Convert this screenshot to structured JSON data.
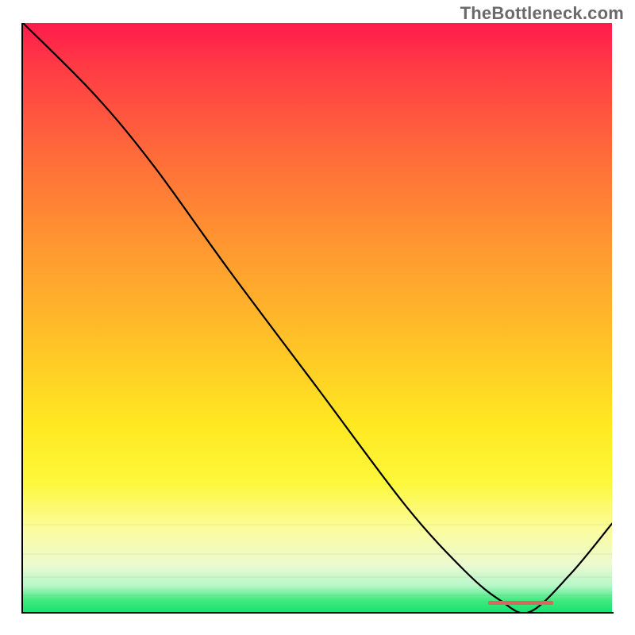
{
  "watermark": "TheBottleneck.com",
  "chart_data": {
    "type": "line",
    "title": "",
    "xlabel": "",
    "ylabel": "",
    "xlim": [
      0,
      100
    ],
    "ylim": [
      0,
      100
    ],
    "grid": false,
    "series": [
      {
        "name": "curve",
        "x": [
          0,
          12,
          22,
          35,
          50,
          65,
          75,
          81,
          86,
          93,
          100
        ],
        "values": [
          100,
          88,
          76,
          58,
          38,
          18,
          7,
          2,
          0,
          6.5,
          15
        ]
      }
    ],
    "optimum_marker": {
      "x_start": 79,
      "x_end": 90,
      "y": 1.5,
      "color": "#d46a5f"
    },
    "background_gradient": {
      "top_color": "#ff1b4c",
      "mid_color": "#ffe821",
      "bottom_color": "#19e36f"
    }
  }
}
